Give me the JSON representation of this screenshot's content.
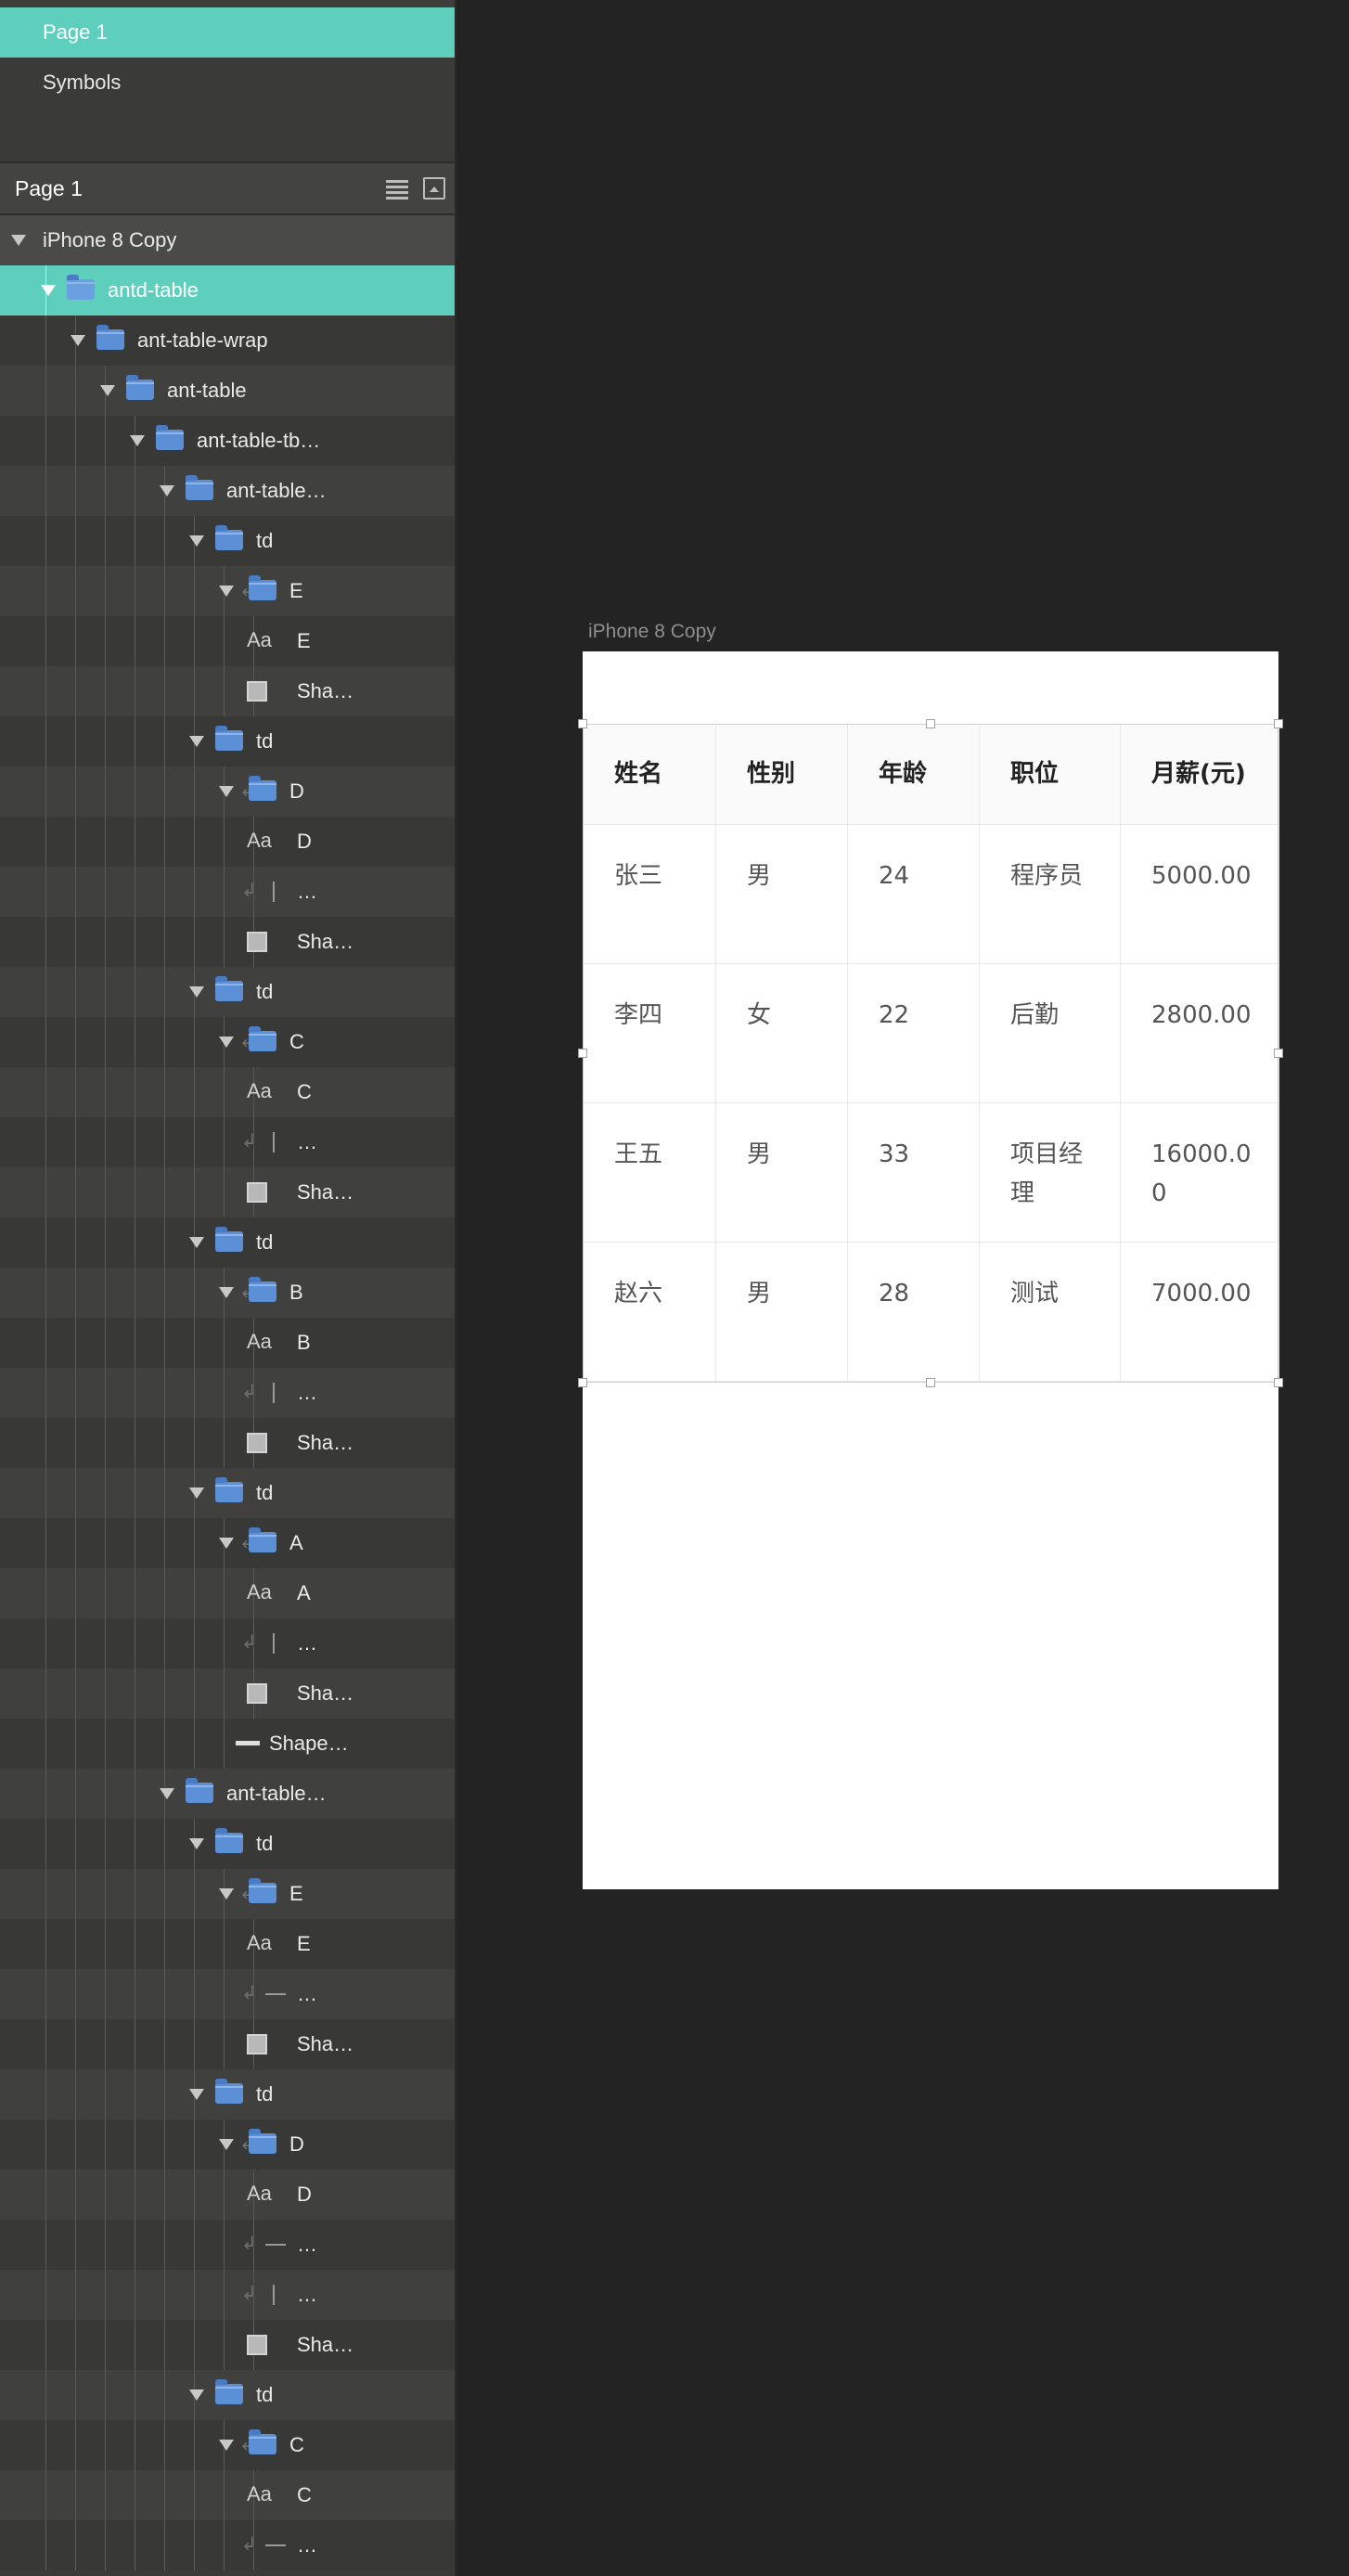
{
  "pages": {
    "items": [
      "Page 1",
      "Symbols"
    ],
    "selected": "Page 1"
  },
  "layers_header": {
    "title": "Page 1"
  },
  "layers": [
    {
      "name": "iPhone 8 Copy",
      "depth": 0,
      "type": "artboard",
      "expanded": true
    },
    {
      "name": "antd-table",
      "depth": 1,
      "type": "group",
      "expanded": true,
      "selected": true
    },
    {
      "name": "ant-table-wrap",
      "depth": 2,
      "type": "group",
      "expanded": true
    },
    {
      "name": "ant-table",
      "depth": 3,
      "type": "group",
      "expanded": true
    },
    {
      "name": "ant-table-tb…",
      "depth": 4,
      "type": "group",
      "expanded": true
    },
    {
      "name": "ant-table…",
      "depth": 5,
      "type": "group",
      "expanded": true
    },
    {
      "name": "td",
      "depth": 6,
      "type": "group",
      "expanded": true
    },
    {
      "name": "E",
      "depth": 7,
      "type": "group",
      "expanded": true,
      "masked": true
    },
    {
      "name": "E",
      "depth": 8,
      "type": "text"
    },
    {
      "name": "Sha…",
      "depth": 8,
      "type": "shape"
    },
    {
      "name": "td",
      "depth": 6,
      "type": "group",
      "expanded": true
    },
    {
      "name": "D",
      "depth": 7,
      "type": "group",
      "expanded": true,
      "masked": true
    },
    {
      "name": "D",
      "depth": 8,
      "type": "text"
    },
    {
      "name": "…",
      "depth": 8,
      "type": "vline",
      "masked": true
    },
    {
      "name": "Sha…",
      "depth": 8,
      "type": "shape"
    },
    {
      "name": "td",
      "depth": 6,
      "type": "group",
      "expanded": true
    },
    {
      "name": "C",
      "depth": 7,
      "type": "group",
      "expanded": true,
      "masked": true
    },
    {
      "name": "C",
      "depth": 8,
      "type": "text"
    },
    {
      "name": "…",
      "depth": 8,
      "type": "vline",
      "masked": true
    },
    {
      "name": "Sha…",
      "depth": 8,
      "type": "shape"
    },
    {
      "name": "td",
      "depth": 6,
      "type": "group",
      "expanded": true
    },
    {
      "name": "B",
      "depth": 7,
      "type": "group",
      "expanded": true,
      "masked": true
    },
    {
      "name": "B",
      "depth": 8,
      "type": "text"
    },
    {
      "name": "…",
      "depth": 8,
      "type": "vline",
      "masked": true
    },
    {
      "name": "Sha…",
      "depth": 8,
      "type": "shape"
    },
    {
      "name": "td",
      "depth": 6,
      "type": "group",
      "expanded": true
    },
    {
      "name": "A",
      "depth": 7,
      "type": "group",
      "expanded": true,
      "masked": true
    },
    {
      "name": "A",
      "depth": 8,
      "type": "text"
    },
    {
      "name": "…",
      "depth": 8,
      "type": "vline",
      "masked": true
    },
    {
      "name": "Sha…",
      "depth": 8,
      "type": "shape"
    },
    {
      "name": "Shape…",
      "depth": 7,
      "type": "line"
    },
    {
      "name": "ant-table…",
      "depth": 5,
      "type": "group",
      "expanded": true
    },
    {
      "name": "td",
      "depth": 6,
      "type": "group",
      "expanded": true
    },
    {
      "name": "E",
      "depth": 7,
      "type": "group",
      "expanded": true,
      "masked": true
    },
    {
      "name": "E",
      "depth": 8,
      "type": "text"
    },
    {
      "name": "…",
      "depth": 8,
      "type": "hline",
      "masked": true
    },
    {
      "name": "Sha…",
      "depth": 8,
      "type": "shape"
    },
    {
      "name": "td",
      "depth": 6,
      "type": "group",
      "expanded": true
    },
    {
      "name": "D",
      "depth": 7,
      "type": "group",
      "expanded": true,
      "masked": true
    },
    {
      "name": "D",
      "depth": 8,
      "type": "text"
    },
    {
      "name": "…",
      "depth": 8,
      "type": "hline",
      "masked": true
    },
    {
      "name": "…",
      "depth": 8,
      "type": "vline",
      "masked": true
    },
    {
      "name": "Sha…",
      "depth": 8,
      "type": "shape"
    },
    {
      "name": "td",
      "depth": 6,
      "type": "group",
      "expanded": true
    },
    {
      "name": "C",
      "depth": 7,
      "type": "group",
      "expanded": true,
      "masked": true
    },
    {
      "name": "C",
      "depth": 8,
      "type": "text"
    },
    {
      "name": "…",
      "depth": 8,
      "type": "hline",
      "masked": true
    }
  ],
  "text_icon_label": "Aa",
  "artboard": {
    "label": "iPhone 8 Copy"
  },
  "table": {
    "columns": [
      "姓名",
      "性别",
      "年龄",
      "职位",
      "月薪(元)"
    ],
    "rows": [
      [
        "张三",
        "男",
        "24",
        "程序员",
        "5000.00"
      ],
      [
        "李四",
        "女",
        "22",
        "后勤",
        "2800.00"
      ],
      [
        "王五",
        "男",
        "33",
        "项目经理",
        "16000.00"
      ],
      [
        "赵六",
        "男",
        "28",
        "测试",
        "7000.00"
      ]
    ]
  },
  "colors": {
    "selection": "#5ecfbd",
    "folder": "#5b8fd6"
  }
}
